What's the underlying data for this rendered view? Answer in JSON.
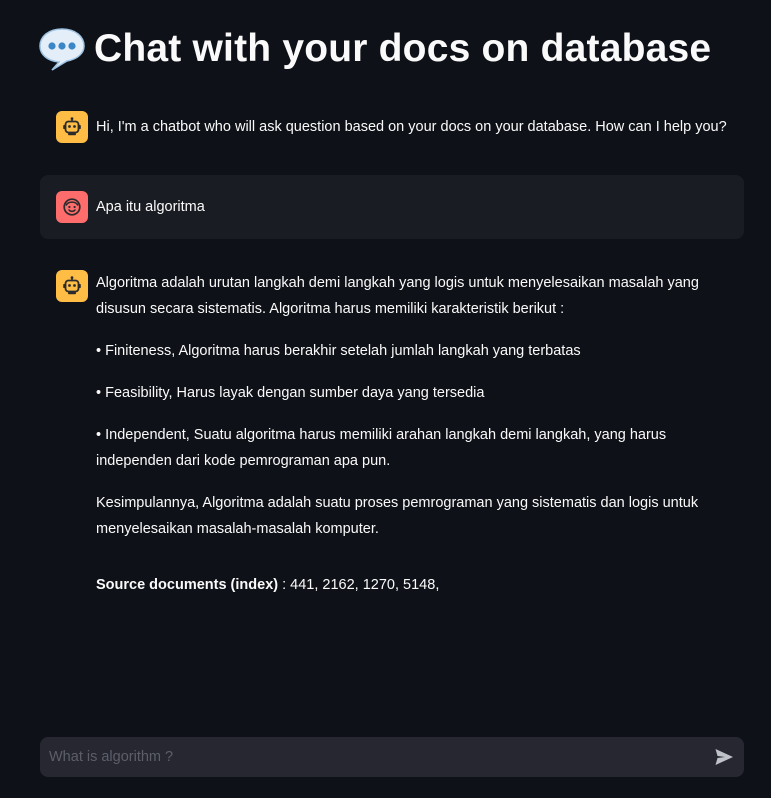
{
  "header": {
    "title": "Chat with your docs on database",
    "title_icon": "speech-balloon-icon"
  },
  "messages": [
    {
      "role": "assistant",
      "avatar_icon": "robot-icon",
      "paragraphs": [
        "Hi, I'm a chatbot who will ask question based on your docs on your database. How can I help you?"
      ]
    },
    {
      "role": "user",
      "avatar_icon": "smiley-face-icon",
      "paragraphs": [
        "Apa itu algoritma"
      ]
    },
    {
      "role": "assistant",
      "avatar_icon": "robot-icon",
      "paragraphs": [
        "Algoritma adalah urutan langkah demi langkah yang logis untuk menyelesaikan masalah yang disusun secara sistematis. Algoritma harus memiliki karakteristik berikut :",
        "• Finiteness, Algoritma harus berakhir setelah jumlah langkah yang terbatas",
        "• Feasibility, Harus layak dengan sumber daya yang tersedia",
        "• Independent, Suatu algoritma harus memiliki arahan langkah demi langkah, yang harus independen dari kode pemrograman apa pun.",
        "Kesimpulannya, Algoritma adalah suatu proses pemrograman yang sistematis dan logis untuk menyelesaikan masalah-masalah komputer."
      ],
      "source_label": "Source documents (index)",
      "source_values": " : 441, 2162, 1270, 5148,"
    }
  ],
  "chat_input": {
    "placeholder": "What is algorithm ?",
    "value": "",
    "send_icon": "send-arrow-icon"
  },
  "colors": {
    "background": "#0e1117",
    "user_bubble": "#1a1c24",
    "input_bg": "#262730",
    "bot_avatar": "#ffbd45",
    "user_avatar": "#ff6c6c",
    "text": "#fafafa"
  }
}
